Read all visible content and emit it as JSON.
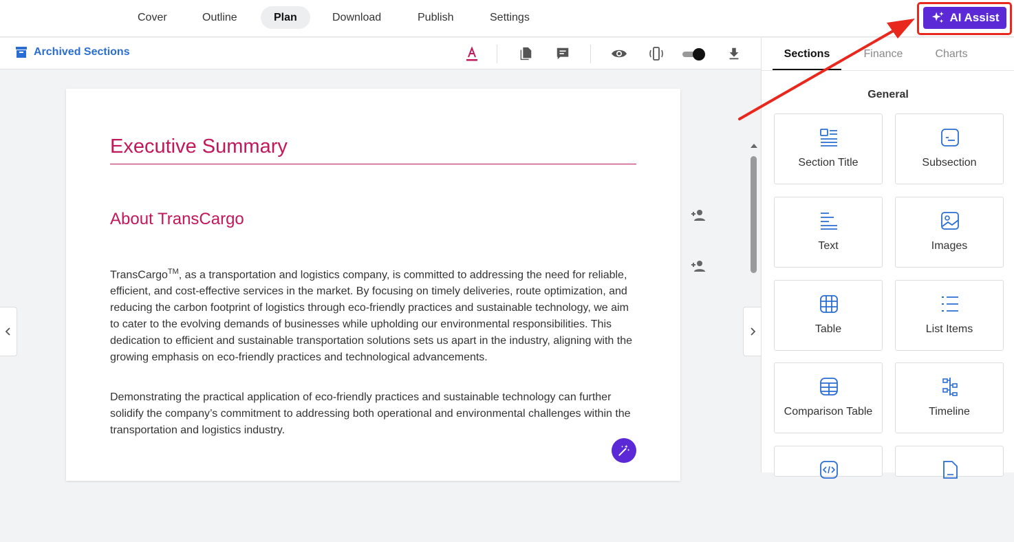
{
  "nav": {
    "tabs": [
      "Cover",
      "Outline",
      "Plan",
      "Download",
      "Publish",
      "Settings"
    ],
    "active": "Plan",
    "ai_assist_label": "AI Assist"
  },
  "toolbar": {
    "archived_label": "Archived Sections"
  },
  "document": {
    "title": "Executive Summary",
    "section_title": "About TransCargo",
    "para1_company": "TransCargo",
    "para1_tm": "TM",
    "para1_rest": ", as a transportation and logistics company, is committed to addressing the need for reliable, efficient, and cost-effective services in the market. By focusing on timely deliveries, route optimization, and reducing the carbon footprint of logistics through eco-friendly practices and sustainable technology, we aim to cater to the evolving demands of businesses while upholding our environmental responsibilities. This dedication to efficient and sustainable transportation solutions sets us apart in the industry, aligning with the growing emphasis on eco-friendly practices and technological advancements.",
    "para2": "Demonstrating the practical application of eco-friendly practices and sustainable technology can further solidify the company’s commitment to addressing both operational and environmental challenges within the transportation and logistics industry."
  },
  "sidepanel": {
    "tabs": [
      "Sections",
      "Finance",
      "Charts"
    ],
    "active_tab": "Sections",
    "group_title": "General",
    "cards": [
      "Section Title",
      "Subsection",
      "Text",
      "Images",
      "Table",
      "List Items",
      "Comparison Table",
      "Timeline"
    ]
  },
  "colors": {
    "accent_purple": "#5b2ad6",
    "heading_pink": "#c2185b",
    "link_blue": "#2b6ed3",
    "annotation_red": "#e8281d"
  }
}
